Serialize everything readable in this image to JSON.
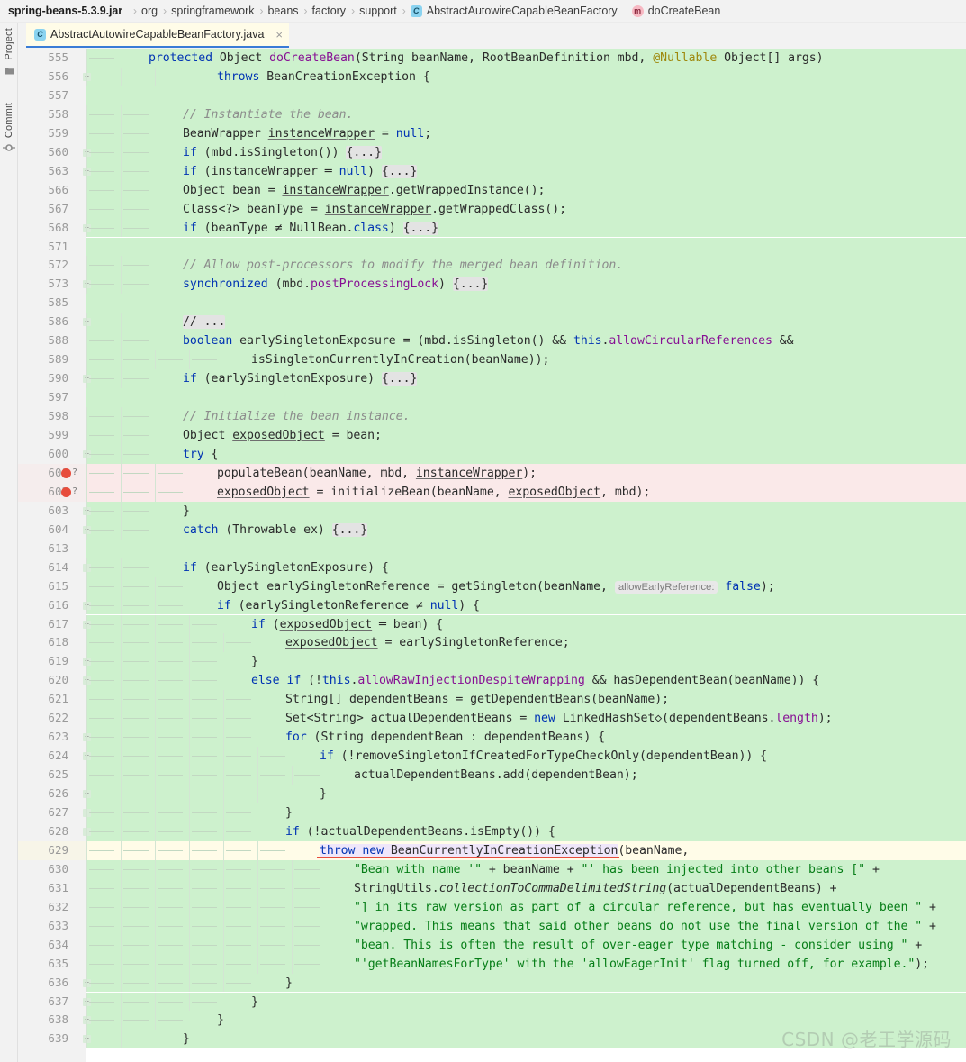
{
  "navbar": {
    "jar": "spring-beans-5.3.9.jar",
    "crumbs": [
      "org",
      "springframework",
      "beans",
      "factory",
      "support"
    ],
    "class_icon": "class-icon",
    "class_name": "AbstractAutowireCapableBeanFactory",
    "method_icon": "method-icon",
    "method_name": "doCreateBean",
    "separator": "›"
  },
  "toolstrip": {
    "items": [
      {
        "label": "Project",
        "icon": "project-folder-icon"
      },
      {
        "label": "Commit",
        "icon": "commit-icon"
      }
    ]
  },
  "tab": {
    "icon": "class-icon",
    "title": "AbstractAutowireCapableBeanFactory.java",
    "close_icon": "close-icon",
    "close_glyph": "×"
  },
  "editor": {
    "watermark": "CSDN @老王学源码",
    "colors": {
      "added_bg": "#cdf1cd",
      "modified_bg": "#fae9e9",
      "caret_bg": "#fffce8",
      "keyword": "#0033b3",
      "string": "#067d17",
      "comment": "#8c8c8c",
      "field": "#871094",
      "annotation": "#9e880d",
      "breakpoint": "#e74c3c",
      "error_underline": "#e74c3c"
    },
    "lines": [
      {
        "n": "555",
        "bg": "add",
        "indent": 1,
        "fold": "",
        "bp": false,
        "html": "<span class=\"kw\">protected</span> Object <span class=\"fld\">doCreateBean</span>(String beanName, RootBeanDefinition mbd, <span class=\"ann\">@Nullable</span> Object[] args)"
      },
      {
        "n": "556",
        "bg": "add",
        "indent": 3,
        "fold": "-",
        "bp": false,
        "html": "<span class=\"kw\">throws</span> BeanCreationException {"
      },
      {
        "n": "557",
        "bg": "add",
        "indent": 0,
        "fold": "",
        "bp": false,
        "html": ""
      },
      {
        "n": "558",
        "bg": "add",
        "indent": 2,
        "fold": "",
        "bp": false,
        "html": "<span class=\"cmt\">// Instantiate the bean.</span>"
      },
      {
        "n": "559",
        "bg": "add",
        "indent": 2,
        "fold": "",
        "bp": false,
        "html": "BeanWrapper <span class=\"lvar\">instanceWrapper</span> = <span class=\"kw\">null</span>;"
      },
      {
        "n": "560",
        "bg": "add",
        "indent": 2,
        "fold": "+",
        "bp": false,
        "html": "<span class=\"kw\">if</span> (mbd.isSingleton()) <span class=\"fold-tok\">{...}</span>"
      },
      {
        "n": "563",
        "bg": "add",
        "indent": 2,
        "fold": "+",
        "bp": false,
        "html": "<span class=\"kw\">if</span> (<span class=\"lvar\">instanceWrapper</span> ═ <span class=\"kw\">null</span>) <span class=\"fold-tok\">{...}</span>"
      },
      {
        "n": "566",
        "bg": "add",
        "indent": 2,
        "fold": "",
        "bp": false,
        "html": "Object bean = <span class=\"lvar\">instanceWrapper</span>.getWrappedInstance();"
      },
      {
        "n": "567",
        "bg": "add",
        "indent": 2,
        "fold": "",
        "bp": false,
        "html": "Class&lt;?&gt; beanType = <span class=\"lvar\">instanceWrapper</span>.getWrappedClass();"
      },
      {
        "n": "568",
        "bg": "add",
        "indent": 2,
        "fold": "+",
        "bp": false,
        "html": "<span class=\"kw\">if</span> (beanType ≠ NullBean.<span class=\"kw\">class</span>) <span class=\"fold-tok\">{...}</span>"
      },
      {
        "n": "571",
        "bg": "add",
        "indent": 0,
        "fold": "",
        "bp": false,
        "html": ""
      },
      {
        "n": "572",
        "bg": "add",
        "indent": 2,
        "fold": "",
        "bp": false,
        "html": "<span class=\"cmt\">// Allow post-processors to modify the merged bean definition.</span>"
      },
      {
        "n": "573",
        "bg": "add",
        "indent": 2,
        "fold": "+",
        "bp": false,
        "html": "<span class=\"kw\">synchronized</span> (mbd.<span class=\"fld\">postProcessingLock</span>) <span class=\"fold-tok\">{...}</span>"
      },
      {
        "n": "585",
        "bg": "add",
        "indent": 0,
        "fold": "",
        "bp": false,
        "html": ""
      },
      {
        "n": "586",
        "bg": "add",
        "indent": 2,
        "fold": "+",
        "bp": false,
        "html": "<span class=\"fold-tok\">// ...</span>"
      },
      {
        "n": "588",
        "bg": "add",
        "indent": 2,
        "fold": "",
        "bp": false,
        "html": "<span class=\"kw\">boolean</span> earlySingletonExposure = (mbd.isSingleton() &amp;&amp; <span class=\"kw\">this</span>.<span class=\"fld\">allowCircularReferences</span> &amp;&amp;"
      },
      {
        "n": "589",
        "bg": "add",
        "indent": 4,
        "fold": "",
        "bp": false,
        "html": "isSingletonCurrentlyInCreation(beanName));"
      },
      {
        "n": "590",
        "bg": "add",
        "indent": 2,
        "fold": "+",
        "bp": false,
        "html": "<span class=\"kw\">if</span> (earlySingletonExposure) <span class=\"fold-tok\">{...}</span>"
      },
      {
        "n": "597",
        "bg": "add",
        "indent": 0,
        "fold": "",
        "bp": false,
        "html": ""
      },
      {
        "n": "598",
        "bg": "add",
        "indent": 2,
        "fold": "",
        "bp": false,
        "html": "<span class=\"cmt\">// Initialize the bean instance.</span>"
      },
      {
        "n": "599",
        "bg": "add",
        "indent": 2,
        "fold": "",
        "bp": false,
        "html": "Object <span class=\"lvar\">exposedObject</span> = bean;"
      },
      {
        "n": "600",
        "bg": "add",
        "indent": 2,
        "fold": "-",
        "bp": false,
        "html": "<span class=\"kw\">try</span> {"
      },
      {
        "n": "601",
        "bg": "mod",
        "indent": 3,
        "fold": "",
        "bp": true,
        "html": "populateBean(beanName, mbd, <span class=\"lvar\">instanceWrapper</span>);"
      },
      {
        "n": "602",
        "bg": "mod",
        "indent": 3,
        "fold": "",
        "bp": true,
        "html": "<span class=\"lvar\">exposedObject</span> = initializeBean(beanName, <span class=\"lvar\">exposedObject</span>, mbd);"
      },
      {
        "n": "603",
        "bg": "add",
        "indent": 2,
        "fold": "-",
        "bp": false,
        "html": "}"
      },
      {
        "n": "604",
        "bg": "add",
        "indent": 2,
        "fold": "+",
        "bp": false,
        "html": "<span class=\"kw\">catch</span> (Throwable ex) <span class=\"fold-tok\">{...}</span>"
      },
      {
        "n": "613",
        "bg": "add",
        "indent": 0,
        "fold": "",
        "bp": false,
        "html": ""
      },
      {
        "n": "614",
        "bg": "add",
        "indent": 2,
        "fold": "-",
        "bp": false,
        "html": "<span class=\"kw\">if</span> (earlySingletonExposure) {"
      },
      {
        "n": "615",
        "bg": "add",
        "indent": 3,
        "fold": "",
        "bp": false,
        "html": "Object earlySingletonReference = getSingleton(beanName, <span class=\"hint\">allowEarlyReference:</span> <span class=\"kw\">false</span>);"
      },
      {
        "n": "616",
        "bg": "add",
        "indent": 3,
        "fold": "-",
        "bp": false,
        "html": "<span class=\"kw\">if</span> (earlySingletonReference ≠ <span class=\"kw\">null</span>) {"
      },
      {
        "n": "617",
        "bg": "add",
        "indent": 4,
        "fold": "-",
        "bp": false,
        "html": "<span class=\"kw\">if</span> (<span class=\"lvar\">exposedObject</span> ═ bean) {"
      },
      {
        "n": "618",
        "bg": "add",
        "indent": 5,
        "fold": "",
        "bp": false,
        "html": "<span class=\"lvar\">exposedObject</span> = earlySingletonReference;"
      },
      {
        "n": "619",
        "bg": "add",
        "indent": 4,
        "fold": "-",
        "bp": false,
        "html": "}"
      },
      {
        "n": "620",
        "bg": "add",
        "indent": 4,
        "fold": "-",
        "bp": false,
        "html": "<span class=\"kw\">else if</span> (!<span class=\"kw\">this</span>.<span class=\"fld\">allowRawInjectionDespiteWrapping</span> &amp;&amp; hasDependentBean(beanName)) {"
      },
      {
        "n": "621",
        "bg": "add",
        "indent": 5,
        "fold": "",
        "bp": false,
        "html": "String[] dependentBeans = getDependentBeans(beanName);"
      },
      {
        "n": "622",
        "bg": "add",
        "indent": 5,
        "fold": "",
        "bp": false,
        "html": "Set&lt;String&gt; actualDependentBeans = <span class=\"kw\">new</span> LinkedHashSet◇(dependentBeans.<span class=\"fld\">length</span>);"
      },
      {
        "n": "623",
        "bg": "add",
        "indent": 5,
        "fold": "-",
        "bp": false,
        "html": "<span class=\"kw\">for</span> (String dependentBean : dependentBeans) {"
      },
      {
        "n": "624",
        "bg": "add",
        "indent": 6,
        "fold": "-",
        "bp": false,
        "html": "<span class=\"kw\">if</span> (!removeSingletonIfCreatedForTypeCheckOnly(dependentBean)) {"
      },
      {
        "n": "625",
        "bg": "add",
        "indent": 7,
        "fold": "",
        "bp": false,
        "html": "actualDependentBeans.add(dependentBean);"
      },
      {
        "n": "626",
        "bg": "add",
        "indent": 6,
        "fold": "-",
        "bp": false,
        "html": "}"
      },
      {
        "n": "627",
        "bg": "add",
        "indent": 5,
        "fold": "-",
        "bp": false,
        "html": "}"
      },
      {
        "n": "628",
        "bg": "add",
        "indent": 5,
        "fold": "-",
        "bp": false,
        "html": "<span class=\"kw\">if</span> (!actualDependentBeans.isEmpty()) {"
      },
      {
        "n": "629",
        "bg": "caret",
        "indent": 6,
        "fold": "",
        "bp": false,
        "errline": true,
        "html": "<span class=\"err\"><span class=\"kw\">throw new</span> BeanCurrentlyInCreationException</span>(beanName,"
      },
      {
        "n": "630",
        "bg": "add",
        "indent": 7,
        "fold": "",
        "bp": false,
        "html": "<span class=\"str\">\"Bean with name '\"</span> + beanName + <span class=\"str\">\"' has been injected into other beans [\"</span> +"
      },
      {
        "n": "631",
        "bg": "add",
        "indent": 7,
        "fold": "",
        "bp": false,
        "html": "StringUtils.<span class=\"stat\">collectionToCommaDelimitedString</span>(actualDependentBeans) +"
      },
      {
        "n": "632",
        "bg": "add",
        "indent": 7,
        "fold": "",
        "bp": false,
        "html": "<span class=\"str\">\"] in its raw version as part of a circular reference, but has eventually been \"</span> +"
      },
      {
        "n": "633",
        "bg": "add",
        "indent": 7,
        "fold": "",
        "bp": false,
        "html": "<span class=\"str\">\"wrapped. This means that said other beans do not use the final version of the \"</span> +"
      },
      {
        "n": "634",
        "bg": "add",
        "indent": 7,
        "fold": "",
        "bp": false,
        "html": "<span class=\"str\">\"bean. This is often the result of over-eager type matching - consider using \"</span> +"
      },
      {
        "n": "635",
        "bg": "add",
        "indent": 7,
        "fold": "",
        "bp": false,
        "html": "<span class=\"str\">\"'getBeanNamesForType' with the 'allowEagerInit' flag turned off, for example.\"</span>);"
      },
      {
        "n": "636",
        "bg": "add",
        "indent": 5,
        "fold": "-",
        "bp": false,
        "html": "}"
      },
      {
        "n": "637",
        "bg": "add",
        "indent": 4,
        "fold": "-",
        "bp": false,
        "html": "}"
      },
      {
        "n": "638",
        "bg": "add",
        "indent": 3,
        "fold": "-",
        "bp": false,
        "html": "}"
      },
      {
        "n": "639",
        "bg": "add",
        "indent": 2,
        "fold": "-",
        "bp": false,
        "html": "}"
      }
    ]
  }
}
